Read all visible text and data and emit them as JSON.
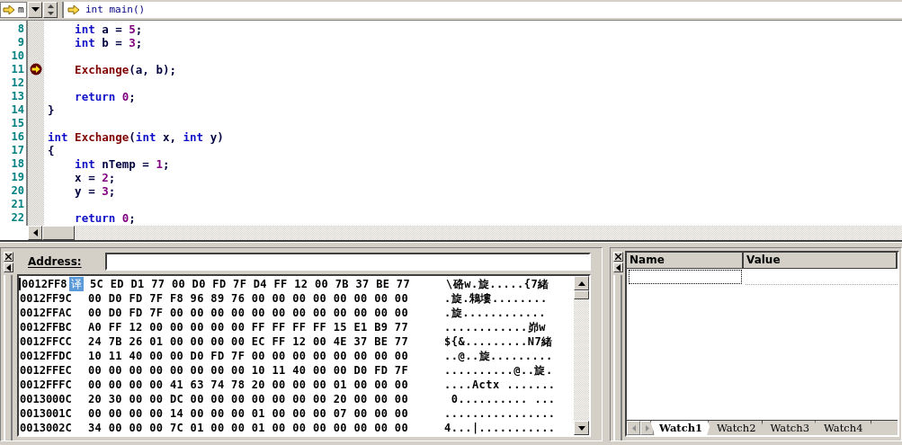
{
  "toolbar": {
    "context_combo": "m",
    "function_field": "int main()"
  },
  "editor": {
    "lines": [
      {
        "number": "8",
        "current": false,
        "tokens": [
          {
            "kind": "keyword",
            "text": "    int"
          },
          {
            "kind": "plain",
            "text": " a = "
          },
          {
            "kind": "number",
            "text": "5"
          },
          {
            "kind": "plain",
            "text": ";"
          }
        ]
      },
      {
        "number": "9",
        "current": false,
        "tokens": [
          {
            "kind": "keyword",
            "text": "    int"
          },
          {
            "kind": "plain",
            "text": " b = "
          },
          {
            "kind": "number",
            "text": "3"
          },
          {
            "kind": "plain",
            "text": ";"
          }
        ]
      },
      {
        "number": "10",
        "current": false
      },
      {
        "number": "11",
        "current": true,
        "tokens": [
          {
            "kind": "function",
            "text": "    Exchange"
          },
          {
            "kind": "plain",
            "text": "(a, b);"
          }
        ]
      },
      {
        "number": "12",
        "current": false
      },
      {
        "number": "13",
        "current": false,
        "tokens": [
          {
            "kind": "keyword",
            "text": "    return "
          },
          {
            "kind": "number",
            "text": "0"
          },
          {
            "kind": "plain",
            "text": ";"
          }
        ]
      },
      {
        "number": "14",
        "current": false,
        "tokens": [
          {
            "kind": "plain",
            "text": "}"
          }
        ]
      },
      {
        "number": "15",
        "current": false
      },
      {
        "number": "16",
        "current": false,
        "tokens": [
          {
            "kind": "keyword",
            "text": "int "
          },
          {
            "kind": "function",
            "text": "Exchange"
          },
          {
            "kind": "plain",
            "text": "("
          },
          {
            "kind": "keyword",
            "text": "int"
          },
          {
            "kind": "plain",
            "text": " x, "
          },
          {
            "kind": "keyword",
            "text": "int"
          },
          {
            "kind": "plain",
            "text": " y)"
          }
        ]
      },
      {
        "number": "17",
        "current": false,
        "tokens": [
          {
            "kind": "plain",
            "text": "{"
          }
        ]
      },
      {
        "number": "18",
        "current": false,
        "tokens": [
          {
            "kind": "keyword",
            "text": "    int"
          },
          {
            "kind": "plain",
            "text": " nTemp = "
          },
          {
            "kind": "number",
            "text": "1"
          },
          {
            "kind": "plain",
            "text": ";"
          }
        ]
      },
      {
        "number": "19",
        "current": false,
        "tokens": [
          {
            "kind": "plain",
            "text": "    x = "
          },
          {
            "kind": "number",
            "text": "2"
          },
          {
            "kind": "plain",
            "text": ";"
          }
        ]
      },
      {
        "number": "20",
        "current": false,
        "tokens": [
          {
            "kind": "plain",
            "text": "    y = "
          },
          {
            "kind": "number",
            "text": "3"
          },
          {
            "kind": "plain",
            "text": ";"
          }
        ]
      },
      {
        "number": "21",
        "current": false
      },
      {
        "number": "22",
        "current": false,
        "tokens": [
          {
            "kind": "keyword",
            "text": "    return "
          },
          {
            "kind": "number",
            "text": "0"
          },
          {
            "kind": "plain",
            "text": ";"
          }
        ]
      }
    ]
  },
  "memory": {
    "address_label": "Address:",
    "overlay_badge": "译",
    "rows": [
      {
        "address": "0012FF8",
        "bytes": "5C ED D1 77 00 D0 FD 7F D4 FF 12 00 7B 37 BE 77",
        "ascii": "\\硌w.旋.....{7緒"
      },
      {
        "address": "0012FF9C",
        "bytes": "00 D0 FD 7F F8 96 89 76 00 00 00 00 00 00 00 00",
        "ascii": ".旋.鴸塿........"
      },
      {
        "address": "0012FFAC",
        "bytes": "00 D0 FD 7F 00 00 00 00 00 00 00 00 00 00 00 00",
        "ascii": ".旋............"
      },
      {
        "address": "0012FFBC",
        "bytes": "A0 FF 12 00 00 00 00 00 FF FF FF FF 15 E1 B9 77",
        "ascii": "............峁w"
      },
      {
        "address": "0012FFCC",
        "bytes": "24 7B 26 01 00 00 00 00 EC FF 12 00 4E 37 BE 77",
        "ascii": "${&.........N7緒"
      },
      {
        "address": "0012FFDC",
        "bytes": "10 11 40 00 00 D0 FD 7F 00 00 00 00 00 00 00 00",
        "ascii": "..@..旋........."
      },
      {
        "address": "0012FFEC",
        "bytes": "00 00 00 00 00 00 00 00 10 11 40 00 00 D0 FD 7F",
        "ascii": "..........@..旋."
      },
      {
        "address": "0012FFFC",
        "bytes": "00 00 00 00 41 63 74 78 20 00 00 00 01 00 00 00",
        "ascii": "....Actx ......."
      },
      {
        "address": "0013000C",
        "bytes": "20 30 00 00 DC 00 00 00 00 00 00 00 20 00 00 00",
        "ascii": " 0.......... ..."
      },
      {
        "address": "0013001C",
        "bytes": "00 00 00 00 14 00 00 00 01 00 00 00 07 00 00 00",
        "ascii": "................"
      },
      {
        "address": "0013002C",
        "bytes": "34 00 00 00 7C 01 00 00 01 00 00 00 00 00 00 00",
        "ascii": "4...|..........."
      }
    ]
  },
  "watch": {
    "columns": [
      "Name",
      "Value"
    ],
    "tabs": [
      {
        "label": "Watch1",
        "selected": true
      },
      {
        "label": "Watch2",
        "selected": false
      },
      {
        "label": "Watch3",
        "selected": false
      },
      {
        "label": "Watch4",
        "selected": false
      }
    ]
  }
}
